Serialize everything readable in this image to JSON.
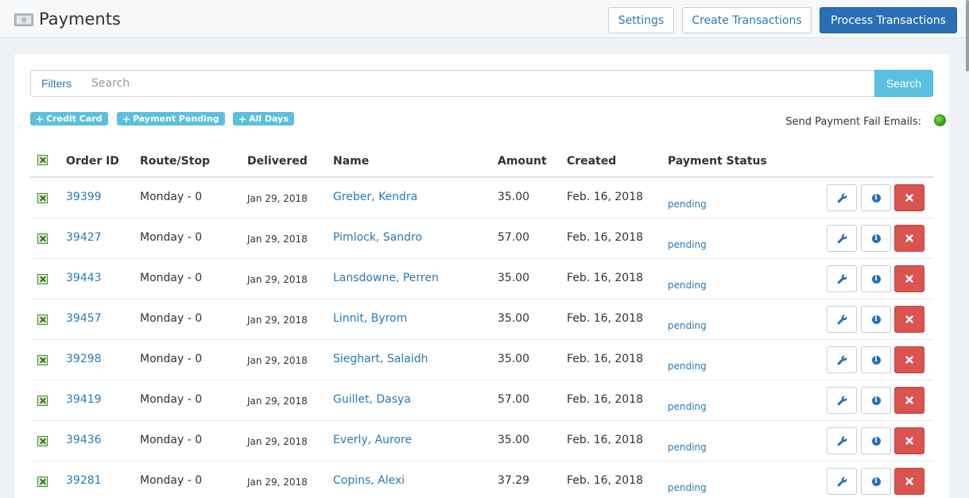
{
  "header": {
    "title": "Payments",
    "buttons": {
      "settings": "Settings",
      "create": "Create Transactions",
      "process": "Process Transactions"
    }
  },
  "search": {
    "filters_label": "Filters",
    "placeholder": "Search",
    "value": "",
    "button_label": "Search"
  },
  "filter_tags": [
    "Credit Card",
    "Payment Pending",
    "All Days"
  ],
  "fail_emails_label": "Send Payment Fail Emails:",
  "table": {
    "columns": [
      "Order ID",
      "Route/Stop",
      "Delivered",
      "Name",
      "Amount",
      "Created",
      "Payment Status"
    ],
    "rows": [
      {
        "order_id": "39399",
        "route": "Monday - 0",
        "delivered": "Jan 29, 2018",
        "name": "Greber, Kendra",
        "amount": "35.00",
        "created": "Feb. 16, 2018",
        "status": "pending"
      },
      {
        "order_id": "39427",
        "route": "Monday - 0",
        "delivered": "Jan 29, 2018",
        "name": "Pimlock, Sandro",
        "amount": "57.00",
        "created": "Feb. 16, 2018",
        "status": "pending"
      },
      {
        "order_id": "39443",
        "route": "Monday - 0",
        "delivered": "Jan 29, 2018",
        "name": "Lansdowne, Perren",
        "amount": "35.00",
        "created": "Feb. 16, 2018",
        "status": "pending"
      },
      {
        "order_id": "39457",
        "route": "Monday - 0",
        "delivered": "Jan 29, 2018",
        "name": "Linnit, Byrom",
        "amount": "35.00",
        "created": "Feb. 16, 2018",
        "status": "pending"
      },
      {
        "order_id": "39298",
        "route": "Monday - 0",
        "delivered": "Jan 29, 2018",
        "name": "Sieghart, Salaidh",
        "amount": "35.00",
        "created": "Feb. 16, 2018",
        "status": "pending"
      },
      {
        "order_id": "39419",
        "route": "Monday - 0",
        "delivered": "Jan 29, 2018",
        "name": "Guillet, Dasya",
        "amount": "57.00",
        "created": "Feb. 16, 2018",
        "status": "pending"
      },
      {
        "order_id": "39436",
        "route": "Monday - 0",
        "delivered": "Jan 29, 2018",
        "name": "Everly, Aurore",
        "amount": "35.00",
        "created": "Feb. 16, 2018",
        "status": "pending"
      },
      {
        "order_id": "39281",
        "route": "Monday - 0",
        "delivered": "Jan 29, 2018",
        "name": "Copins, Alexi",
        "amount": "37.29",
        "created": "Feb. 16, 2018",
        "status": "pending"
      }
    ]
  },
  "icons": {
    "title": "money-icon",
    "row_actions": [
      "wrench-icon",
      "info-icon",
      "delete-icon"
    ],
    "select": "checkbox-icon",
    "fail_email_status": "status-dot-icon"
  },
  "colors": {
    "primary": "#2a6fb5",
    "link": "#2a7ab5",
    "info": "#5bc0de",
    "danger": "#d9534f",
    "status_on": "#3fb21a"
  }
}
